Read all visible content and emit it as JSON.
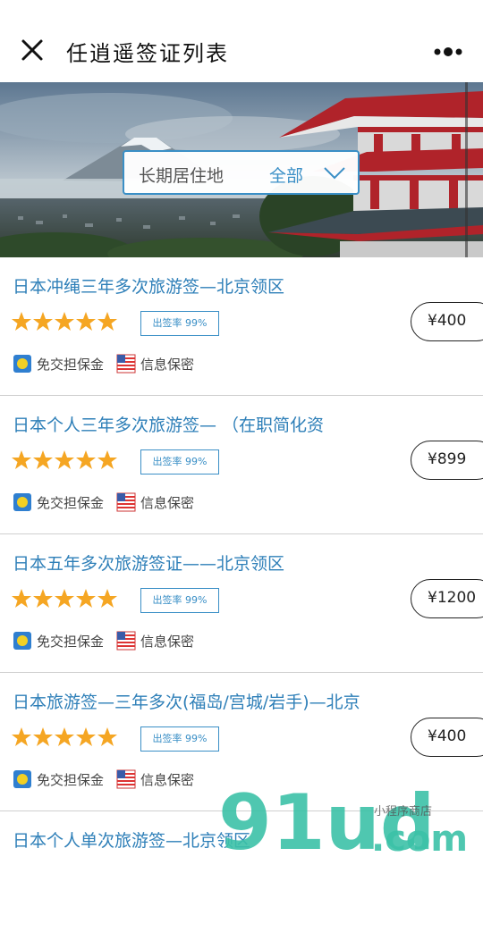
{
  "header": {
    "title": "任逍遥签证列表"
  },
  "filter": {
    "label": "长期居住地",
    "value": "全部"
  },
  "items": [
    {
      "name": "日本冲绳三年多次旅游签—北京领区",
      "rate": "出签率 99%",
      "price": "¥400",
      "stars": 5,
      "tag1": "免交担保金",
      "tag2": "信息保密"
    },
    {
      "name": "日本个人三年多次旅游签— （在职简化资",
      "rate": "出签率 99%",
      "price": "¥899",
      "stars": 5,
      "tag1": "免交担保金",
      "tag2": "信息保密"
    },
    {
      "name": "日本五年多次旅游签证——北京领区",
      "rate": "出签率 99%",
      "price": "¥1200",
      "stars": 5,
      "tag1": "免交担保金",
      "tag2": "信息保密"
    },
    {
      "name": "日本旅游签—三年多次(福岛/宫城/岩手)—北京",
      "rate": "出签率 99%",
      "price": "¥400",
      "stars": 5,
      "tag1": "免交担保金",
      "tag2": "信息保密"
    },
    {
      "name": "日本个人单次旅游签—北京领区",
      "rate": "",
      "price": "",
      "stars": 0,
      "tag1": "",
      "tag2": ""
    }
  ],
  "watermark": {
    "brand": "91ud",
    "domain": ".com",
    "tagline": "小程序商店"
  },
  "colors": {
    "accent": "#3a8fc6",
    "star": "#f5a623"
  }
}
